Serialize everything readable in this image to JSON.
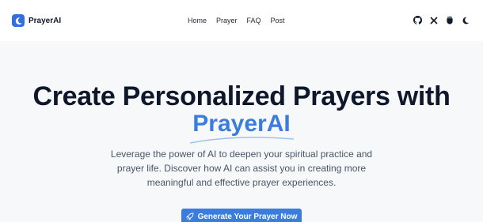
{
  "header": {
    "brand": "PrayerAI",
    "nav": [
      "Home",
      "Prayer",
      "FAQ",
      "Post"
    ],
    "icons": [
      "github-icon",
      "x-icon",
      "product-hunt-icon",
      "moon-icon"
    ]
  },
  "hero": {
    "title": "Create Personalized Prayers with",
    "brand_highlight": "PrayerAI",
    "description": "Leverage the power of AI to deepen your spiritual practice and prayer life. Discover how AI can assist you in creating more meaningful and effective prayer experiences.",
    "cta_label": "Generate Your Prayer Now"
  },
  "colors": {
    "accent": "#3b7ddd",
    "title": "#0f172a",
    "text": "#475569",
    "background": "#f7f8fa"
  }
}
